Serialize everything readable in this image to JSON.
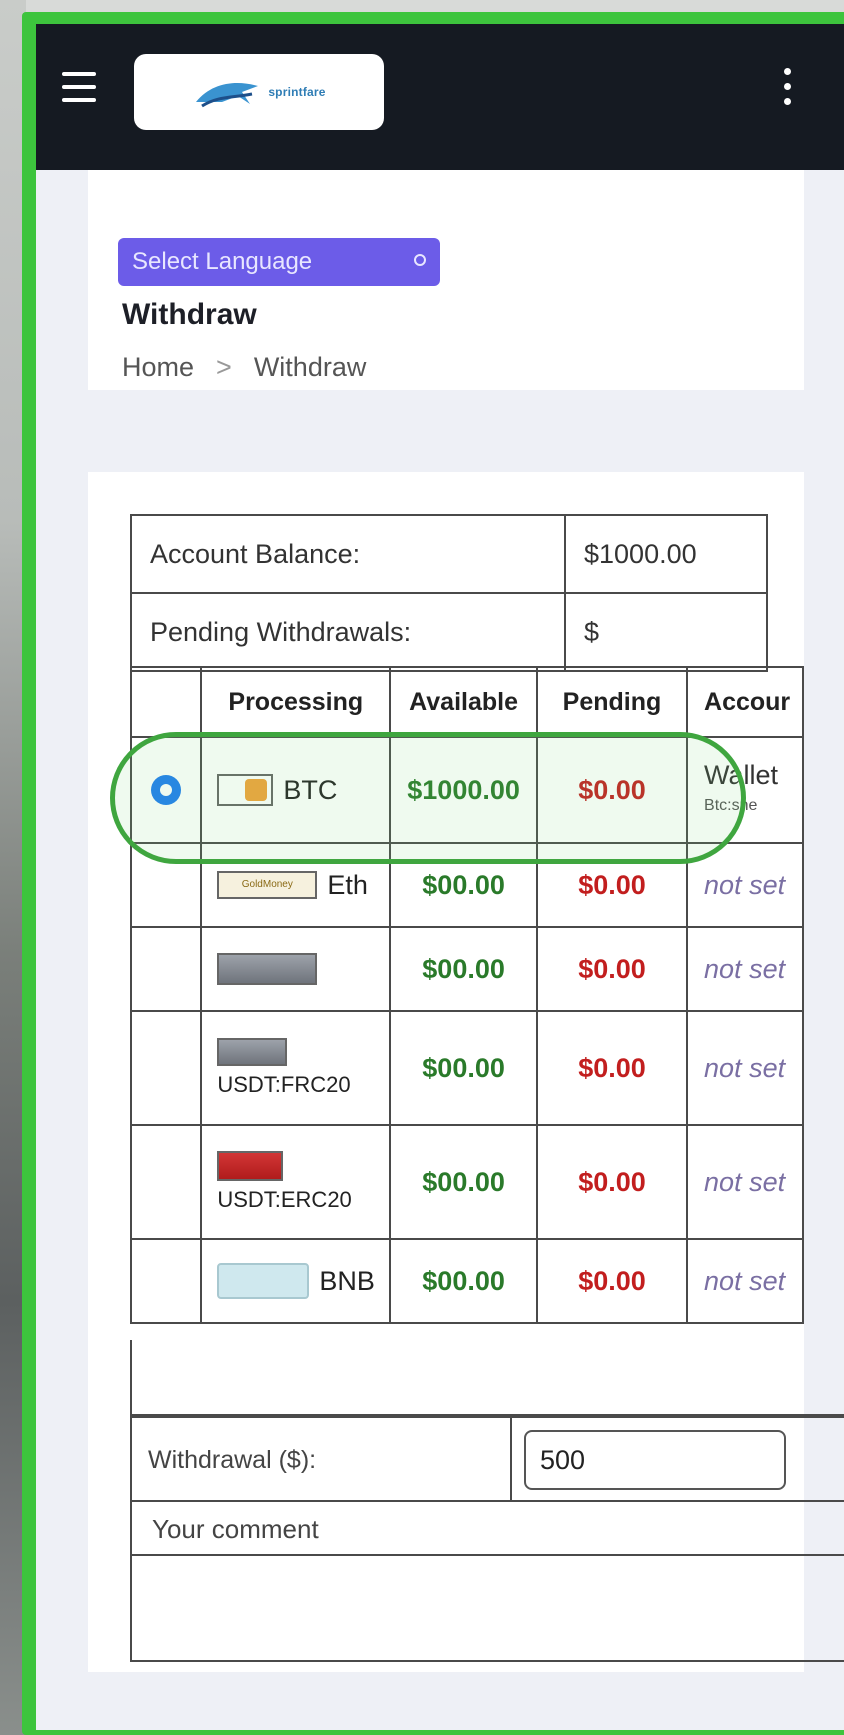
{
  "navbar": {
    "logo_text": "sprintfare"
  },
  "header": {
    "language_button": "Select Language",
    "page_title": "Withdraw",
    "breadcrumb": [
      "Home",
      "Withdraw"
    ],
    "breadcrumb_separator": ">"
  },
  "balance": {
    "account_balance_label": "Account Balance:",
    "account_balance_value": "$1000.00",
    "pending_label": "Pending Withdrawals:",
    "pending_value": "$"
  },
  "processors": {
    "headers": [
      "Processing",
      "Available",
      "Pending",
      "Accour"
    ],
    "rows": [
      {
        "name": "BTC",
        "available": "$1000.00",
        "pending": "$0.00",
        "account": "Wallet",
        "account_sub": "Btc:sne",
        "selected": true
      },
      {
        "name": "Eth",
        "logo_text": "GoldMoney",
        "available": "$00.00",
        "pending": "$0.00",
        "account": "not set"
      },
      {
        "name": "",
        "available": "$00.00",
        "pending": "$0.00",
        "account": "not set"
      },
      {
        "name": "USDT:FRC20",
        "available": "$00.00",
        "pending": "$0.00",
        "account": "not set"
      },
      {
        "name": "USDT:ERC20",
        "available": "$00.00",
        "pending": "$0.00",
        "account": "not set"
      },
      {
        "name": "BNB",
        "available": "$00.00",
        "pending": "$0.00",
        "account": "not set"
      }
    ]
  },
  "form": {
    "withdrawal_label": "Withdrawal ($):",
    "withdrawal_value": "500",
    "comment_label": "Your comment"
  },
  "colors": {
    "navbar": "#151a22",
    "language_button": "#6c5ce8",
    "available_green": "#2a7a2a",
    "pending_red": "#c21e1e",
    "highlight": "#3fa63f",
    "frame_green": "#3dc43d"
  }
}
